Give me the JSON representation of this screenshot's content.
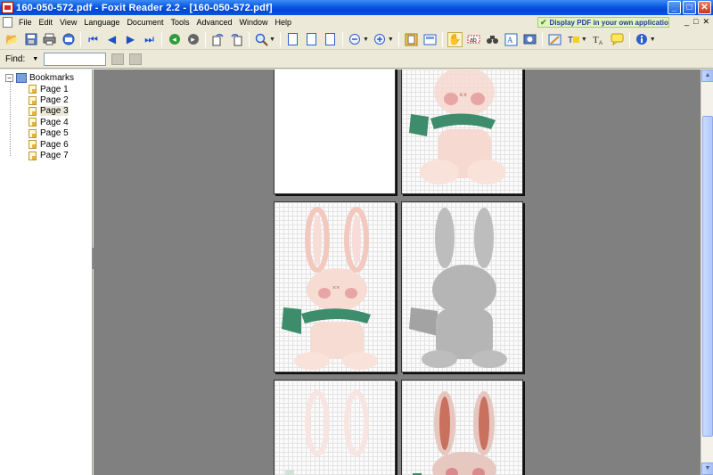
{
  "window": {
    "title": "160-050-572.pdf - Foxit Reader 2.2 - [160-050-572.pdf]",
    "buttons": {
      "minimize": "_",
      "maximize": "□",
      "close": "✕"
    }
  },
  "menu": {
    "items": [
      "File",
      "Edit",
      "View",
      "Language",
      "Document",
      "Tools",
      "Advanced",
      "Window",
      "Help"
    ],
    "ad_text": "Display PDF in your own applications",
    "mdi_buttons": [
      "_",
      "□",
      "✕"
    ]
  },
  "toolbar": {
    "icons": [
      "open-icon",
      "save-icon",
      "print-icon",
      "email-icon",
      "first-page-icon",
      "previous-page-icon",
      "next-page-icon",
      "last-page-icon",
      "go-back-icon",
      "go-forward-icon",
      "rotate-left-icon",
      "rotate-right-icon",
      "zoom-icon",
      "actual-size-icon",
      "fit-page-icon",
      "fit-width-icon",
      "zoom-out-icon",
      "zoom-in-icon",
      "single-page-icon",
      "continuous-icon",
      "hand-tool-icon",
      "select-text-icon",
      "snapshot-icon",
      "find-icon",
      "image-tool-icon",
      "pencil-icon",
      "highlighter-icon",
      "typewriter-icon",
      "note-icon",
      "info-icon"
    ]
  },
  "find": {
    "label": "Find:",
    "value": ""
  },
  "bookmarks": {
    "root_label": "Bookmarks",
    "toggle": "−",
    "pages": [
      "Page 1",
      "Page 2",
      "Page 3",
      "Page 4",
      "Page 5",
      "Page 6",
      "Page 7"
    ],
    "selected_index": 2
  },
  "colors": {
    "titlebar": "#0a5ae0",
    "viewer_background": "#808080",
    "bunny_pink": "#f2c8bf",
    "bunny_cheek": "#e7a5a5",
    "scarf_green": "#3d8c6b",
    "bunny_grey": "#9c9c9c",
    "bunny_red_ears": "#c9705f"
  }
}
